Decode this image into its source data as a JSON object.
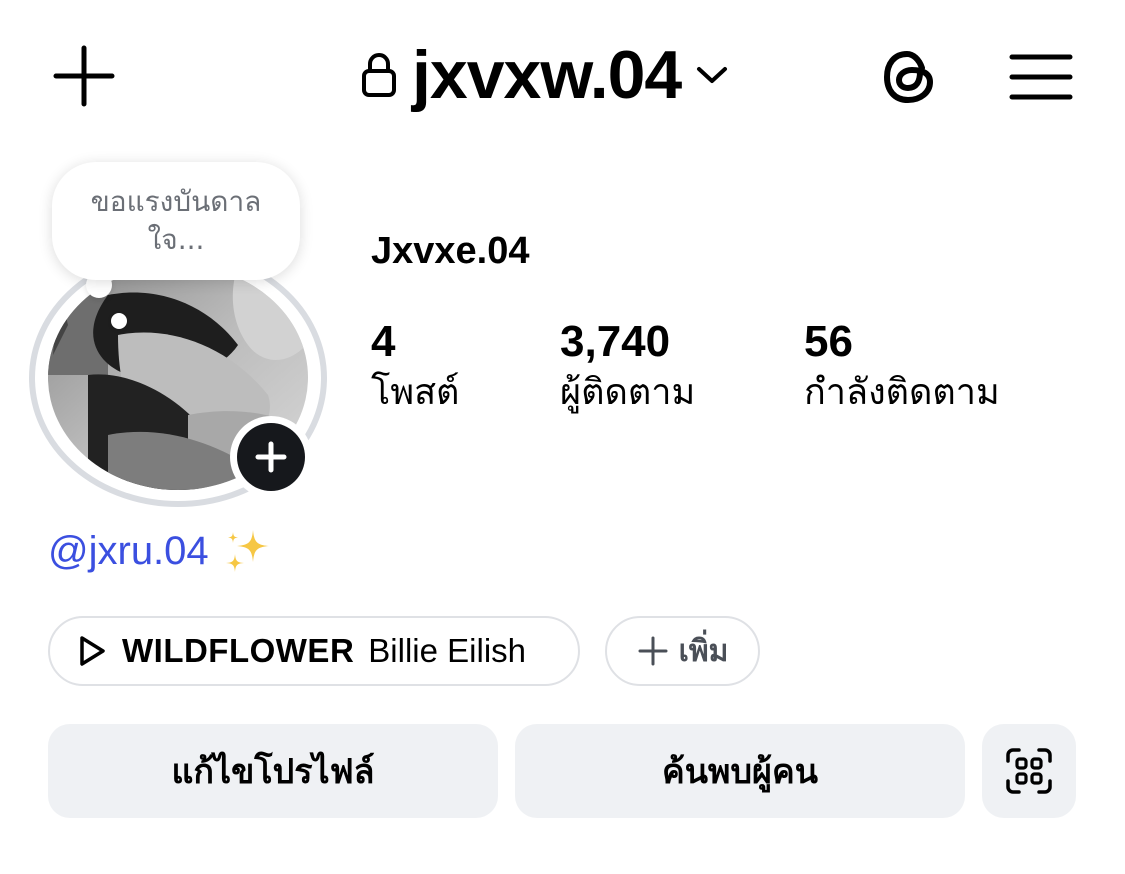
{
  "header": {
    "username": "jxvxw.04",
    "icons": {
      "new_post": "plus-icon",
      "lock": "lock-icon",
      "switch_account": "chevron-down-icon",
      "threads": "threads-icon",
      "menu": "hamburger-menu-icon"
    }
  },
  "profile": {
    "note": "ขอแรงบันดาลใจ...",
    "display_name": "Jxvxe.04",
    "stats": [
      {
        "value": "4",
        "label": "โพสต์"
      },
      {
        "value": "3,740",
        "label": "ผู้ติดตาม"
      },
      {
        "value": "56",
        "label": "กำลังติดตาม"
      }
    ],
    "mention": "@jxru.04",
    "mention_emoji": "✨"
  },
  "music": {
    "title": "WILDFLOWER",
    "artist": "Billie Eilish"
  },
  "add_pill": {
    "label": "เพิ่ม"
  },
  "buttons": {
    "edit_profile": "แก้ไขโปรไฟล์",
    "discover_people": "ค้นพบผู้คน"
  },
  "colors": {
    "mention_link": "#3b4fe0",
    "button_bg": "#eff1f4",
    "add_story_bg": "#16181c"
  }
}
